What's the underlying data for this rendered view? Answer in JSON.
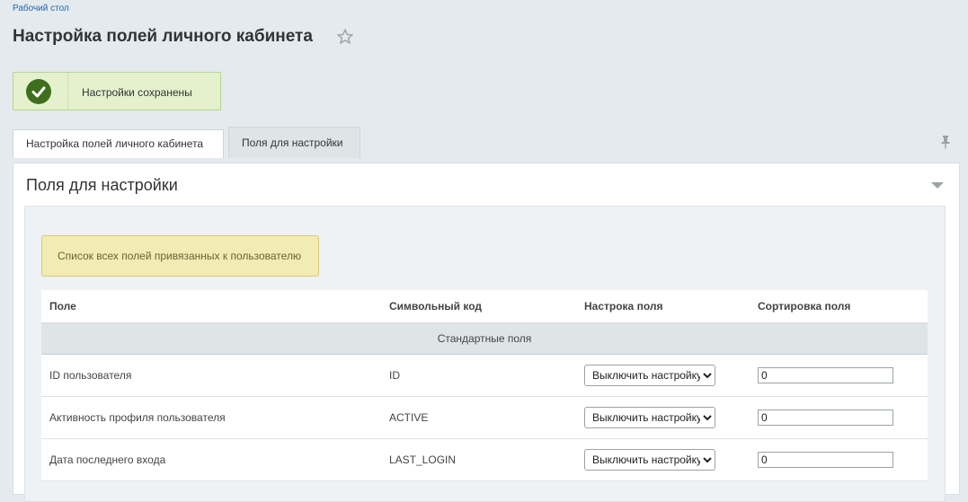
{
  "breadcrumb": "Рабочий стол",
  "page_title": "Настройка полей личного кабинета",
  "notice": {
    "text": "Настройки сохранены",
    "status_color": "#3f6e1e"
  },
  "tabs": [
    {
      "label": "Настройка полей личного кабинета",
      "active": false
    },
    {
      "label": "Поля для настройки",
      "active": true
    }
  ],
  "panel": {
    "title": "Поля для настройки",
    "hint": "Список всех полей привязанных к пользователю"
  },
  "table": {
    "columns": [
      "Поле",
      "Символьный код",
      "Настрока поля",
      "Сортировка поля"
    ],
    "group_label": "Стандартные поля",
    "rows": [
      {
        "name": "ID пользователя",
        "code": "ID",
        "setting": "Выключить настройку",
        "sort": "0"
      },
      {
        "name": "Активность профиля пользователя",
        "code": "ACTIVE",
        "setting": "Выключить настройку",
        "sort": "0"
      },
      {
        "name": "Дата последнего входа",
        "code": "LAST_LOGIN",
        "setting": "Выключить настройку",
        "sort": "0"
      }
    ]
  },
  "icons": {
    "favorite": "star-icon",
    "notice": "checkmark-icon",
    "pin": "pin-icon",
    "collapse": "triangle-down-icon"
  }
}
